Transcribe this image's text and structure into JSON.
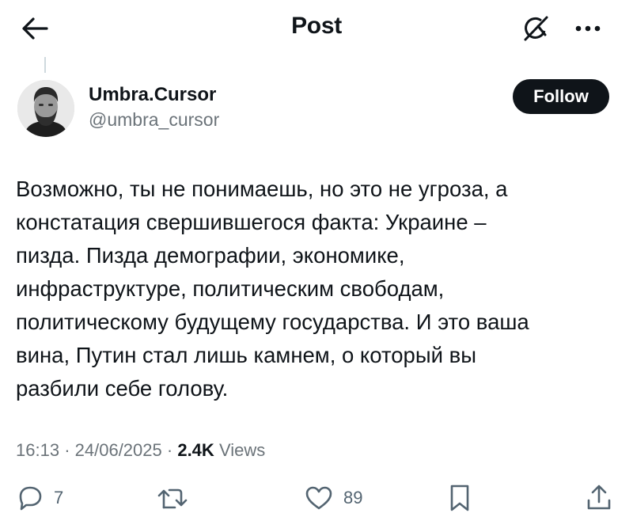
{
  "header": {
    "title": "Post",
    "back_icon": "arrow-left-icon",
    "grok_icon": "grok-icon",
    "more_icon": "more-horizontal-icon"
  },
  "author": {
    "display_name": "Umbra.Cursor",
    "handle": "@umbra_cursor",
    "avatar": "avatar-photo",
    "follow_label": "Follow"
  },
  "tweet": {
    "lines": [
      "Возможно, ты не понимаешь, но это не угроза, а",
      "констатация свершившегося факта: Украине –",
      "пизда. Пизда демографии, экономике,",
      "инфраструктуре, политическим свободам,",
      "политическому будущему государства. И это ваша",
      "вина, Путин стал лишь камнем, о который вы",
      "разбили себе голову."
    ],
    "time": "16:13",
    "separator": "·",
    "date": "24/06/2025",
    "views_count": "2.4K",
    "views_label": "Views"
  },
  "actions": {
    "replies": "7",
    "likes": "89",
    "reply_icon": "reply-icon",
    "repost_icon": "repost-icon",
    "like_icon": "heart-icon",
    "bookmark_icon": "bookmark-icon",
    "share_icon": "share-icon"
  },
  "colors": {
    "text": "#0f1419",
    "secondary": "#6b7379",
    "follow_bg": "#0f1419",
    "follow_text": "#ffffff",
    "thread_line": "#cfd9de"
  }
}
